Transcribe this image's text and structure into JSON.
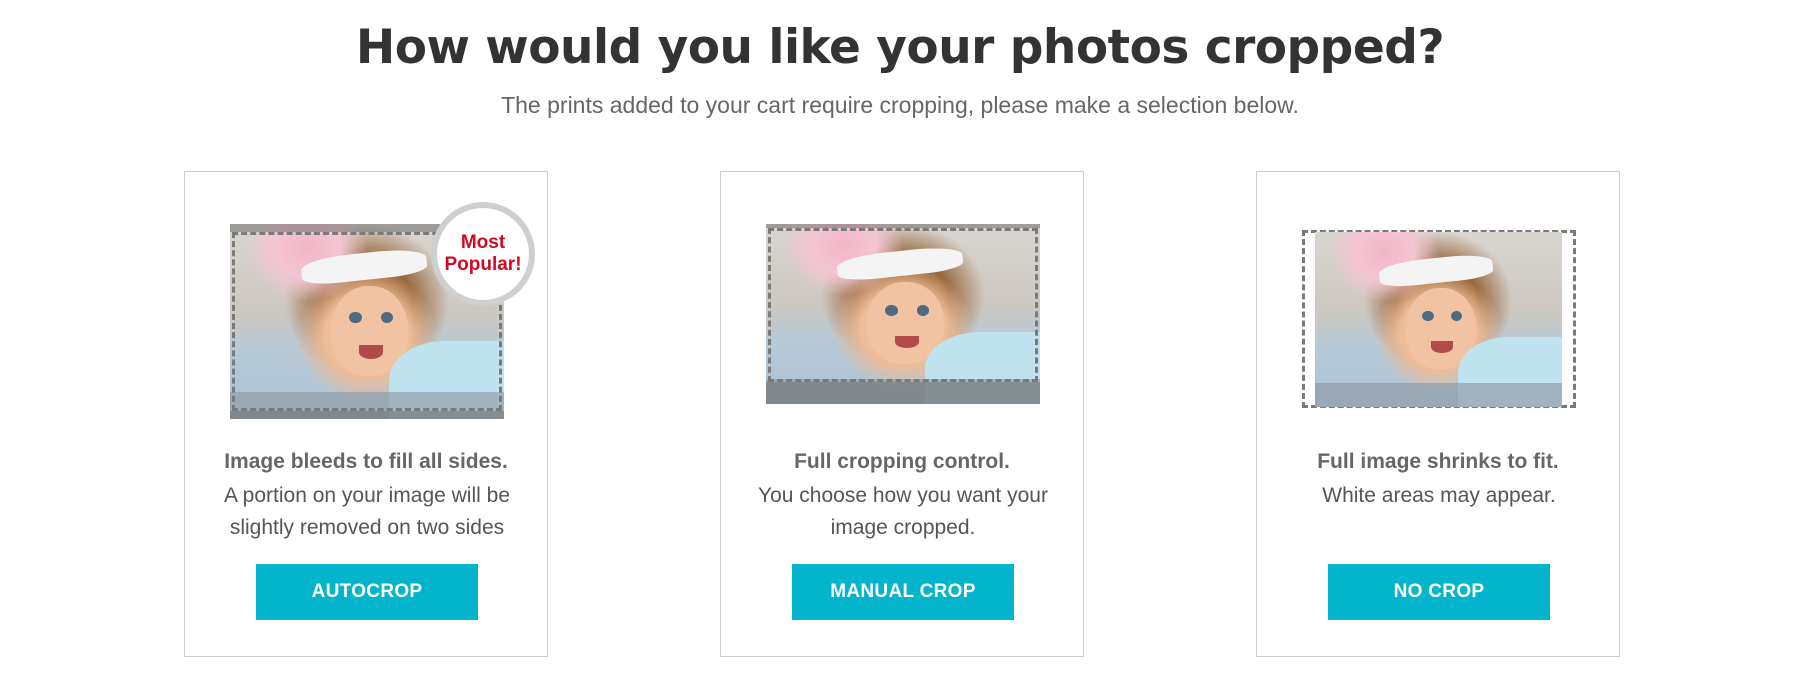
{
  "header": {
    "title": "How would you like your photos cropped?",
    "subtitle": "The prints added to your cart require cropping, please make a selection below."
  },
  "options": [
    {
      "badge": "Most Popular!",
      "title": "Image bleeds to fill all sides.",
      "description": "A portion on your image will be slightly removed on two sides",
      "button": "AUTOCROP"
    },
    {
      "title": "Full cropping control.",
      "description": "You choose how you want your image cropped.",
      "button": "MANUAL CROP"
    },
    {
      "title": "Full image shrinks to fit.",
      "description": "White areas may appear.",
      "button": "NO CROP"
    }
  ],
  "colors": {
    "button": "#03b5cc",
    "badge_text": "#d10a1f",
    "card_border": "#cfcfcf"
  }
}
